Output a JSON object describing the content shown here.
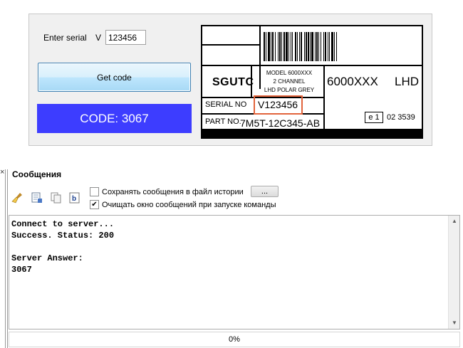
{
  "serial_form": {
    "label": "Enter serial",
    "prefix": "V",
    "value": "123456",
    "button_label": "Get code",
    "code_text": "CODE: 3067",
    "code_bg": "#3d3dff"
  },
  "label_card": {
    "brand": "SGUTC",
    "model_lines": [
      "MODEL 6000XXX",
      "2 CHANNEL",
      "LHD POLAR GREY"
    ],
    "model_big": "6000XXX",
    "side": "LHD",
    "serial_no_label": "SERIAL NO",
    "serial_no_value": "V123456",
    "part_no_label": "PART NO.",
    "part_no_value": "7M5T-12C345-AB",
    "e_mark": "e 1",
    "e_number": "02 3539",
    "highlight_color": "#e2643c"
  },
  "messages": {
    "close_glyph": "×",
    "title": "Сообщения",
    "toolbar_icons": [
      "broom-icon",
      "save-log-icon",
      "copy-icon",
      "text-format-icon"
    ],
    "save_history_label": "Сохранять сообщения в файл истории",
    "save_history_checked": false,
    "browse_label": "...",
    "clear_on_start_label": "Очищать окно сообщений при запуске команды",
    "clear_on_start_checked": true,
    "console_lines": [
      "Connect to server...",
      "Success. Status: 200",
      "",
      "Server Answer:",
      "3067"
    ]
  },
  "progress": {
    "value_text": "0%",
    "fraction": 0
  }
}
